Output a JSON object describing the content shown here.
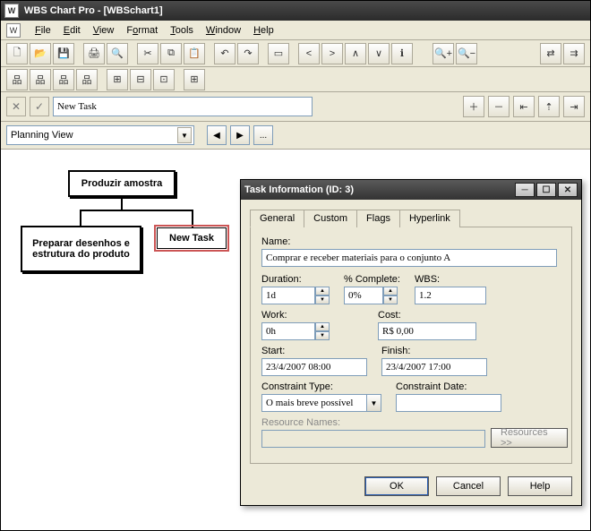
{
  "app": {
    "title": "WBS Chart Pro - [WBSchart1]"
  },
  "menu": {
    "file": "File",
    "edit": "Edit",
    "view": "View",
    "format": "Format",
    "tools": "Tools",
    "window": "Window",
    "help": "Help"
  },
  "toolbar1_icons": {
    "new": "new",
    "open": "open",
    "save": "save",
    "print": "print",
    "preview": "preview",
    "cut": "cut",
    "copy": "copy",
    "paste": "paste",
    "undo": "undo",
    "redo": "redo",
    "box": "box",
    "left": "<",
    "right": ">",
    "up": "∧",
    "down": "∨",
    "info": "i",
    "zoomin": "+",
    "zoomout": "−",
    "link1": "link",
    "link2": "link"
  },
  "nameBar": {
    "value": "New Task"
  },
  "viewBar": {
    "view": "Planning View",
    "ellipsis": "..."
  },
  "wbs": {
    "root": "Produzir amostra",
    "child1": "Preparar desenhos e estrutura do produto",
    "child2": "New Task"
  },
  "dialog": {
    "title": "Task Information (ID: 3)",
    "tabs": {
      "general": "General",
      "custom": "Custom",
      "flags": "Flags",
      "hyperlink": "Hyperlink"
    },
    "labels": {
      "name": "Name:",
      "duration": "Duration:",
      "pct": "% Complete:",
      "wbs": "WBS:",
      "work": "Work:",
      "cost": "Cost:",
      "start": "Start:",
      "finish": "Finish:",
      "ctype": "Constraint Type:",
      "cdate": "Constraint Date:",
      "res": "Resource Names:"
    },
    "values": {
      "name": "Comprar e receber materiais para o conjunto A",
      "duration": "1d",
      "pct": "0%",
      "wbs": "1.2",
      "work": "0h",
      "cost": "R$ 0,00",
      "start": "23/4/2007 08:00",
      "finish": "23/4/2007 17:00",
      "ctype": "O mais breve possível",
      "cdate": "",
      "res": ""
    },
    "buttons": {
      "ok": "OK",
      "cancel": "Cancel",
      "help": "Help",
      "resources": "Resources >>"
    }
  }
}
